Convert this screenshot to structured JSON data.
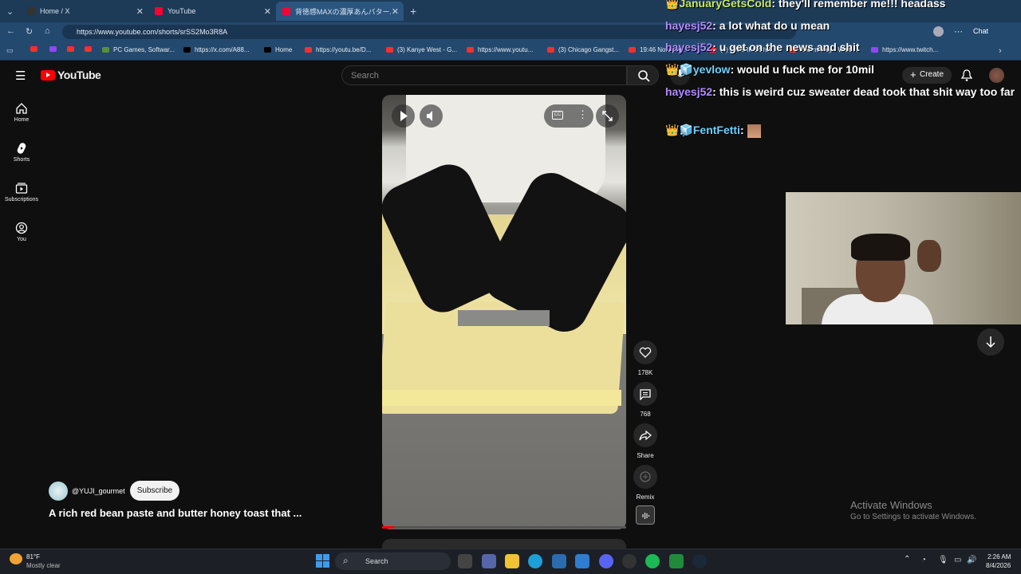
{
  "browser": {
    "tabs": [
      {
        "title": "Home / X"
      },
      {
        "title": "YouTube"
      },
      {
        "title": "背徳感MAXの濃厚あんバターハニート…"
      }
    ],
    "url": "https://www.youtube.com/shorts/srSS2Mo3R8A",
    "bookmarks": [
      "PC Games, Softwar...",
      "https://x.com/A88...",
      "Home",
      "https://youtu.be/D...",
      "(3) Kanye West - G...",
      "https://www.youtu...",
      "(3) Chicago Gangst...",
      "19:46 Now pla...",
      "(4) TWERKS Shri...",
      "LoL money - Waiti...",
      "https://www.twitch..."
    ],
    "chat_button": "Chat"
  },
  "youtube": {
    "logo": "YouTube",
    "search_placeholder": "Search",
    "create_label": "Create",
    "sidebar": [
      {
        "label": "Home"
      },
      {
        "label": "Shorts"
      },
      {
        "label": "Subscriptions"
      },
      {
        "label": "You"
      }
    ],
    "channel": "@YUJI_gourmet",
    "subscribe_label": "Subscribe",
    "video_title": "A rich red bean paste and butter honey toast that ...",
    "actions": {
      "likes": "178K",
      "comments": "768",
      "share": "Share",
      "remix": "Remix"
    },
    "progress": 0.05
  },
  "chat": [
    {
      "user": "JanuaryGetsCold",
      "message": "they'll remember me!!! headass",
      "color": "green"
    },
    {
      "user": "hayesj52",
      "message": "a lot what do u mean",
      "color": "purple"
    },
    {
      "user": "hayesj52",
      "message": "u get on the news and shit",
      "color": "purple"
    },
    {
      "user": "yevlow",
      "message": "would u fuck me for 10mil",
      "color": "cyan"
    },
    {
      "user": "hayesj52",
      "message": "this is weird cuz sweater dead took that shit way too far",
      "color": "purple"
    },
    {
      "user": "FentFetti",
      "message": "",
      "color": "cyan"
    }
  ],
  "watermark": {
    "title": "Activate Windows",
    "subtitle": "Go to Settings to activate Windows."
  },
  "taskbar": {
    "weather_temp": "81°F",
    "weather_desc": "Mostly clear",
    "search_label": "Search",
    "time": "2:26 AM",
    "date": "8/4/2026"
  }
}
